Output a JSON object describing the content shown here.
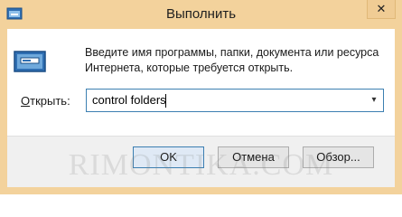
{
  "window": {
    "title": "Выполнить",
    "close_label": "✕"
  },
  "icons": {
    "app": "run-dialog-icon",
    "run": "run-program-icon"
  },
  "description": {
    "line1": "Введите имя программы, папки, документа или ресурса",
    "line2": "Интернета, которые требуется открыть."
  },
  "open_field": {
    "label_prefix": "О",
    "label_rest": "ткрыть:",
    "value": "control folders"
  },
  "buttons": {
    "ok": "OK",
    "cancel": "Отмена",
    "browse": "Обзор..."
  },
  "watermark": "RIMONTIKA.COM",
  "colors": {
    "titlebar": "#f3d29c",
    "accent_border": "#3c7fb1"
  }
}
